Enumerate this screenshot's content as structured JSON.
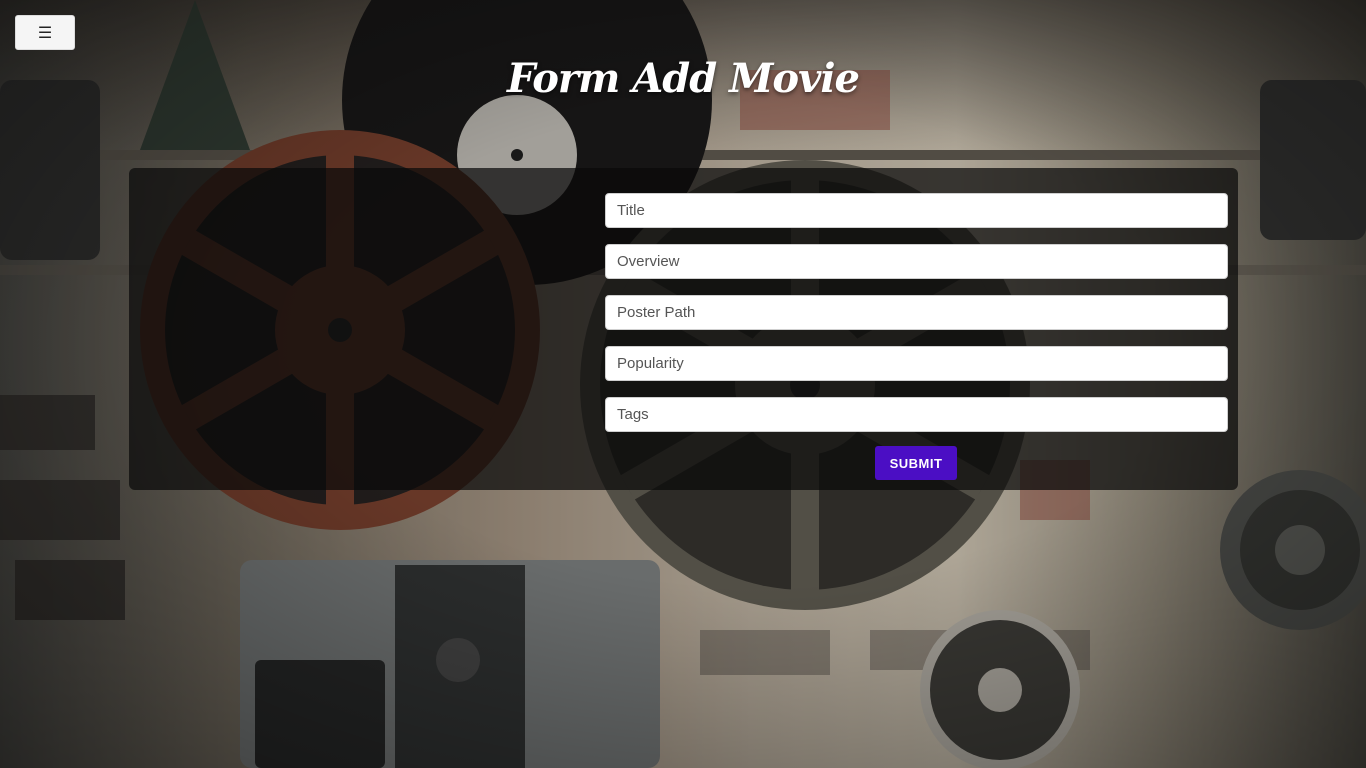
{
  "menu": {
    "icon": "hamburger-icon",
    "glyph": "☰"
  },
  "page": {
    "title": "Form Add Movie"
  },
  "form": {
    "fields": [
      {
        "placeholder": "Title",
        "value": ""
      },
      {
        "placeholder": "Overview",
        "value": ""
      },
      {
        "placeholder": "Poster Path",
        "value": ""
      },
      {
        "placeholder": "Popularity",
        "value": ""
      },
      {
        "placeholder": "Tags",
        "value": ""
      }
    ],
    "submit_label": "SUBMIT"
  },
  "colors": {
    "accent": "#4b0ec4",
    "panel": "rgba(10,10,10,0.72)",
    "title": "#ffffff"
  }
}
